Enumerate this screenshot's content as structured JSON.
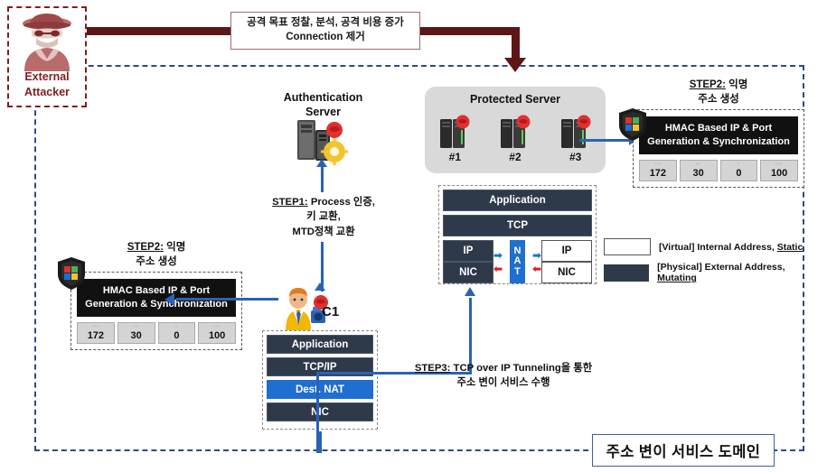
{
  "attacker": {
    "label_line1": "External",
    "label_line2": "Attacker",
    "icon": "hacker-icon",
    "color": "#7e1f1f"
  },
  "attack_message": {
    "line1": "공격 목표 정찰, 분석, 공격 비용 증가",
    "line2": "Connection 제거"
  },
  "auth_server": {
    "title_line1": "Authentication",
    "title_line2": "Server",
    "icon": "server-tower-icon"
  },
  "step1": {
    "label": "STEP1:",
    "text_rest": " Process 인증,",
    "line2": "키 교환,",
    "line3": "MTD정책 교환"
  },
  "protected_server": {
    "title": "Protected Server",
    "servers": [
      {
        "name": "#1",
        "icon": "server-rack-icon"
      },
      {
        "name": "#2",
        "icon": "server-rack-icon"
      },
      {
        "name": "#3",
        "icon": "server-rack-icon"
      }
    ]
  },
  "server_stack": {
    "application": "Application",
    "tcp": "TCP",
    "ip_left": "IP",
    "nic_left": "NIC",
    "ip_right": "IP",
    "nic_right": "NIC",
    "nat": "NAT"
  },
  "hmac_right": {
    "step_label": "STEP2:",
    "step_rest": " 익명",
    "step_line2": "주소 생성",
    "title_line1": "HMAC Based IP & Port",
    "title_line2": "Generation & Synchronization",
    "values": [
      "172",
      "30",
      "0",
      "100"
    ],
    "blurred": [
      "···",
      "··",
      "·",
      "···"
    ],
    "icon": "shield-icon"
  },
  "hmac_left": {
    "step_label": "STEP2:",
    "step_rest": " 익명",
    "step_line2": "주소 생성",
    "title_line1": "HMAC Based IP & Port",
    "title_line2": "Generation & Synchronization",
    "values": [
      "172",
      "30",
      "0",
      "100"
    ],
    "blurred": [
      "···",
      "··",
      "·",
      "···"
    ],
    "icon": "shield-icon"
  },
  "legend": {
    "rows": [
      {
        "swatch": "white",
        "prefix": "[Virtual] Internal Address, ",
        "emphasis": "Static"
      },
      {
        "swatch": "dark",
        "prefix": "[Physical] External Address, ",
        "emphasis": "Mutating"
      }
    ]
  },
  "client": {
    "name": "C1",
    "icon": "user-worker-icon",
    "stack": {
      "application": "Application",
      "tcpip": "TCP/IP",
      "dest_nat": "Dest. NAT",
      "nic": "NIC"
    }
  },
  "step3": {
    "label": "STEP3:",
    "text_rest": " TCP over IP Tunneling을 통한",
    "line2": "주소 변이 서비스 수행"
  },
  "domain": {
    "label": "주소 변이 서비스 도메인",
    "border_color": "#2b4a8b"
  },
  "colors": {
    "attack_red": "#5e1616",
    "arrow_blue": "#2a62b5",
    "nat_blue": "#1f6fd0",
    "dark_layer": "#2e3a4a",
    "group_gray": "#d9d9d9"
  }
}
